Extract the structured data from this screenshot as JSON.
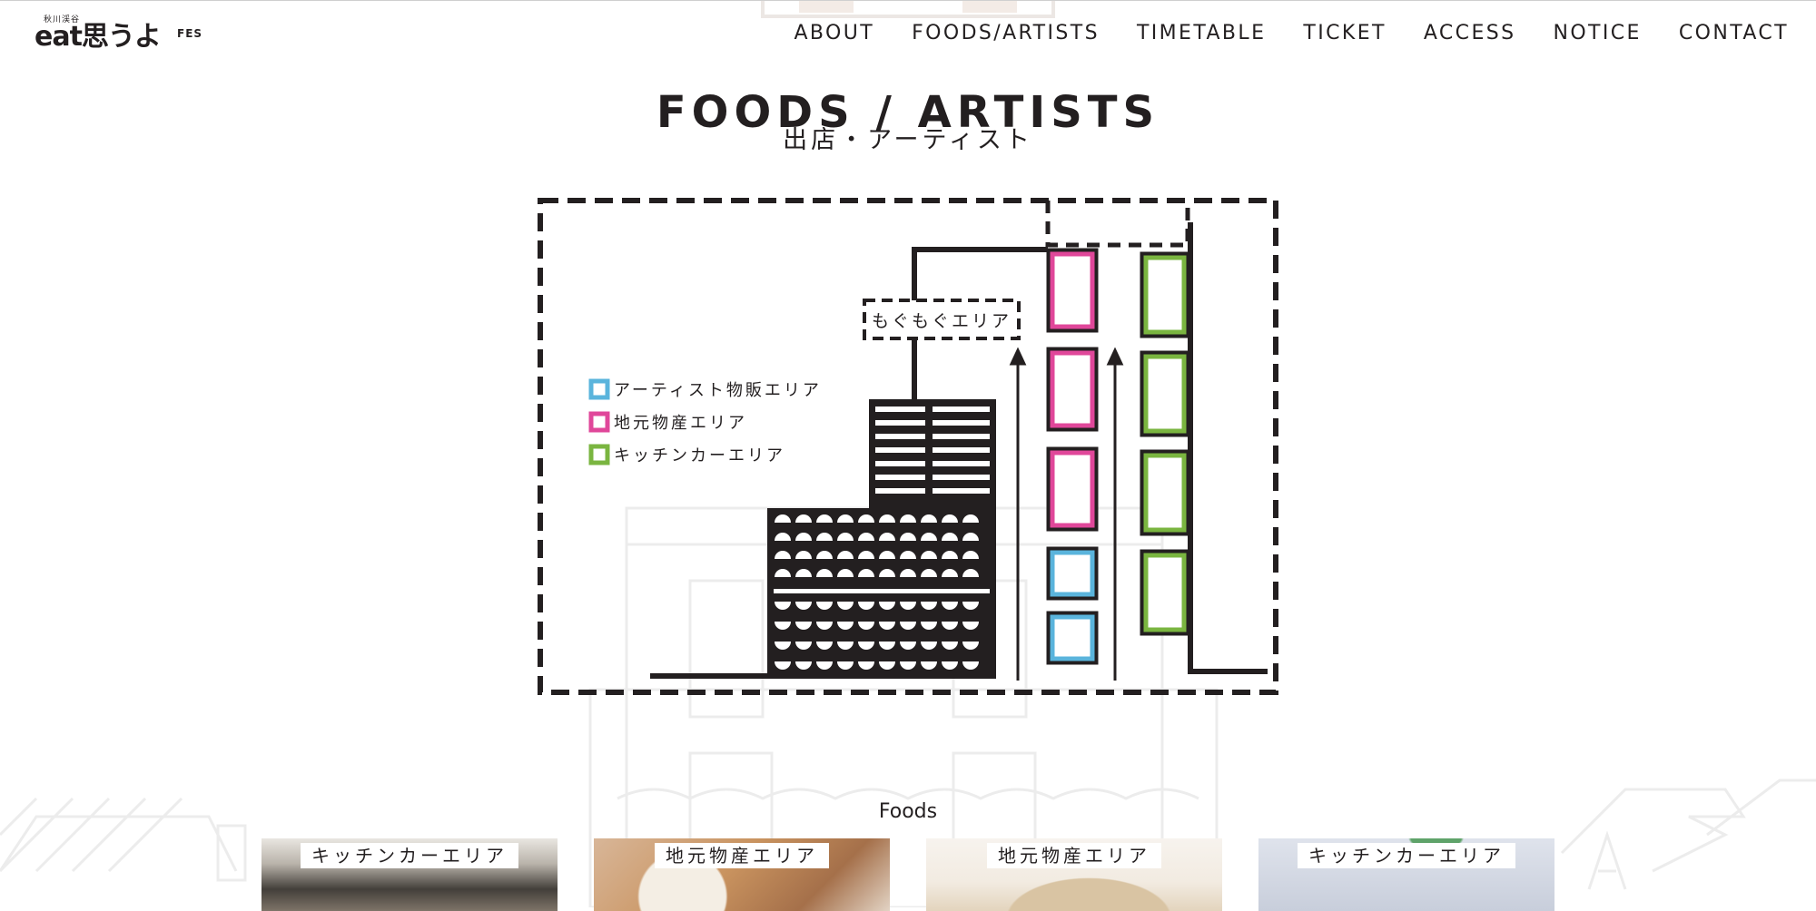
{
  "header": {
    "logo": {
      "small_text": "秋川渓谷",
      "main_text": "eat思うよ",
      "suffix_text": "FES"
    },
    "nav": [
      {
        "label": "ABOUT"
      },
      {
        "label": "FOODS/ARTISTS"
      },
      {
        "label": "TIMETABLE"
      },
      {
        "label": "TICKET"
      },
      {
        "label": "ACCESS"
      },
      {
        "label": "NOTICE"
      },
      {
        "label": "CONTACT"
      }
    ]
  },
  "main": {
    "title": "FOODS / ARTISTS",
    "subtitle": "出店・アーティスト",
    "map": {
      "zone_label": "もぐもぐエリア",
      "legend": [
        {
          "label": "アーティスト物販エリア",
          "color": "#5ab4dc"
        },
        {
          "label": "地元物産エリア",
          "color": "#e0479a"
        },
        {
          "label": "キッチンカーエリア",
          "color": "#7ab540"
        }
      ]
    },
    "foods_heading": "Foods",
    "cards": [
      {
        "tag": "キッチンカーエリア"
      },
      {
        "tag": "地元物産エリア"
      },
      {
        "tag": "地元物産エリア"
      },
      {
        "tag": "キッチンカーエリア"
      }
    ]
  },
  "colors": {
    "ink": "#231f20",
    "background": "#ffffff",
    "faint_illustration": "#ececec"
  }
}
